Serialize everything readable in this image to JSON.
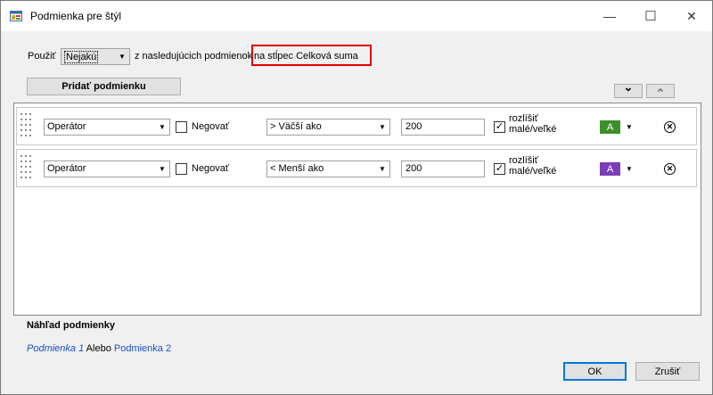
{
  "window": {
    "title": "Podmienka pre štýl",
    "minimize_glyph": "—",
    "maximize_glyph": "☐",
    "close_glyph": "✕",
    "icon": "app-window-icon"
  },
  "header": {
    "apply_label": "Použiť",
    "apply_value": "Nejakú",
    "conditions_text": "z nasledujúcich podmienok",
    "column_text": "na stĺpec Celková suma"
  },
  "toolbar": {
    "add_condition_label": "Pridať podmienku",
    "down_glyph": "⌄",
    "up_glyph": "⌃"
  },
  "conditions": [
    {
      "field": "Operátor",
      "negate_label": "Negovať",
      "negate_checked": false,
      "operator": ">  Väčší ako",
      "value": "200",
      "case_checked": true,
      "case_label_1": "rozlíšiť",
      "case_label_2": "malé/veľké",
      "style_letter": "A",
      "style_color": "#3e8f2c",
      "remove_glyph": "✕"
    },
    {
      "field": "Operátor",
      "negate_label": "Negovať",
      "negate_checked": false,
      "operator": "<  Menší ako",
      "value": "200",
      "case_checked": true,
      "case_label_1": "rozlíšiť",
      "case_label_2": "malé/veľké",
      "style_letter": "A",
      "style_color": "#7b3db8",
      "remove_glyph": "✕"
    }
  ],
  "preview": {
    "title": "Náhľad podmienky",
    "part1": "Podmienka 1",
    "conj": "Alebo",
    "part2": "Podmienka 2"
  },
  "footer": {
    "ok_label": "OK",
    "cancel_label": "Zrušiť"
  },
  "check_glyph": "✓",
  "dropdown_glyph": "▼"
}
